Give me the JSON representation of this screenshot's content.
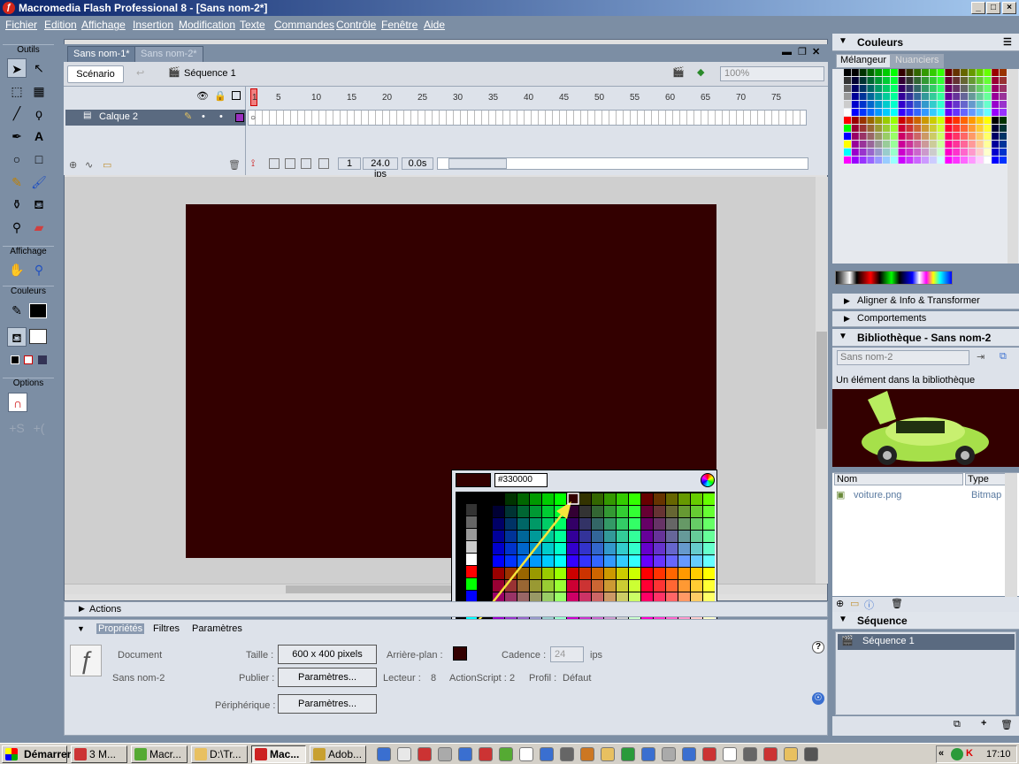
{
  "window": {
    "title": "Macromedia Flash Professional 8 - [Sans nom-2*]",
    "btn_min": "_",
    "btn_max": "□",
    "btn_close": "×"
  },
  "menu": [
    "Fichier",
    "Edition",
    "Affichage",
    "Insertion",
    "Modification",
    "Texte",
    "Commandes",
    "Contrôle",
    "Fenêtre",
    "Aide"
  ],
  "toolbox": {
    "sections": {
      "tools": "Outils",
      "view": "Affichage",
      "colors": "Couleurs",
      "options": "Options"
    }
  },
  "documents": {
    "tabs": [
      "Sans nom-1*",
      "Sans nom-2*"
    ],
    "active_tab": 1
  },
  "editbar": {
    "scene_button": "Scénario",
    "sequence": "Séquence 1",
    "zoom": "100%"
  },
  "timeline": {
    "layer": "Calque 2",
    "frame_numbers": [
      "1",
      "5",
      "10",
      "15",
      "20",
      "25",
      "30",
      "35",
      "40",
      "45",
      "50",
      "55",
      "60",
      "65",
      "70",
      "75"
    ],
    "current_frame": "1",
    "fps": "24.0 ips",
    "time": "0.0s"
  },
  "stage": {
    "background_color": "#330000",
    "width": "600",
    "height": "400"
  },
  "color_popup": {
    "hex": "#330000"
  },
  "panels": {
    "colors": {
      "title": "Couleurs",
      "tabs": [
        "Mélangeur",
        "Nuanciers"
      ]
    },
    "align": "Aligner & Info & Transformer",
    "behaviors": "Comportements",
    "library": {
      "title": "Bibliothèque - Sans nom-2",
      "dropdown": "Sans nom-2",
      "count_text": "Un élément dans la bibliothèque",
      "col_name": "Nom",
      "col_type": "Type",
      "items": [
        {
          "name": "voiture.png",
          "type": "Bitmap"
        }
      ]
    },
    "scene": {
      "title": "Séquence",
      "items": [
        "Séquence 1"
      ]
    }
  },
  "actions_panel": "Actions",
  "properties": {
    "tabs": [
      "Propriétés",
      "Filtres",
      "Paramètres"
    ],
    "doc_label": "Document",
    "doc_name": "Sans nom-2",
    "size_label": "Taille :",
    "size_value": "600 x 400 pixels",
    "bg_label": "Arrière-plan :",
    "fps_label": "Cadence :",
    "fps_value": "24",
    "fps_unit": "ips",
    "publish_label": "Publier :",
    "publish_btn": "Paramètres...",
    "player_label": "Lecteur :",
    "player_value": "8",
    "as_label": "ActionScript :",
    "as_value": "2",
    "profile_label": "Profil :",
    "profile_value": "Défaut",
    "device_label": "Périphérique :",
    "device_btn": "Paramètres..."
  },
  "taskbar": {
    "start": "Démarrer",
    "tasks": [
      {
        "label": "3 M...",
        "color": "#cc3333"
      },
      {
        "label": "Macr...",
        "color": "#55aa33"
      },
      {
        "label": "D:\\Tr...",
        "color": "#e8c060"
      },
      {
        "label": "Mac...",
        "color": "#cc2222"
      },
      {
        "label": "Adob...",
        "color": "#c8a030"
      }
    ],
    "clock": "17:10"
  }
}
